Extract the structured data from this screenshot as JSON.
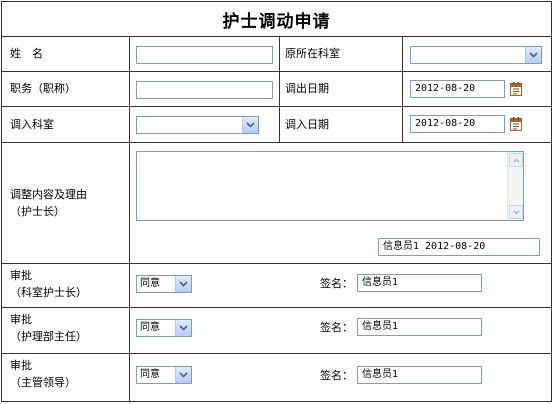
{
  "form": {
    "title": "护士调动申请",
    "name_label": "姓　名",
    "name_value": "",
    "origin_dept_label": "原所在科室",
    "origin_dept_value": "",
    "position_label": "职务（职称）",
    "position_value": "",
    "out_date_label": "调出日期",
    "out_date_value": "2012-08-20",
    "in_dept_label": "调入科室",
    "in_dept_value": "",
    "in_date_label": "调入日期",
    "in_date_value": "2012-08-20",
    "reason_label_1": "调整内容及理由",
    "reason_label_2": "（护士长）",
    "reason_value": "",
    "reason_signature": "信息员1 2012-08-20"
  },
  "approvals": [
    {
      "label_1": "审批",
      "label_2": "（科室护士长）",
      "decision": "同意",
      "sign_label": "签名：",
      "signer": "信息员1"
    },
    {
      "label_1": "审批",
      "label_2": "（护理部主任）",
      "decision": "同意",
      "sign_label": "签名：",
      "signer": "信息员1"
    },
    {
      "label_1": "审批",
      "label_2": "（主管领导）",
      "decision": "同意",
      "sign_label": "签名：",
      "signer": "信息员1"
    }
  ],
  "colors": {
    "border": "#333333",
    "input_border": "#7f9db9",
    "dropdown_arrow": "#4d6185"
  },
  "icons": {
    "dropdown": "chevron-down-icon",
    "calendar": "calendar-icon"
  }
}
